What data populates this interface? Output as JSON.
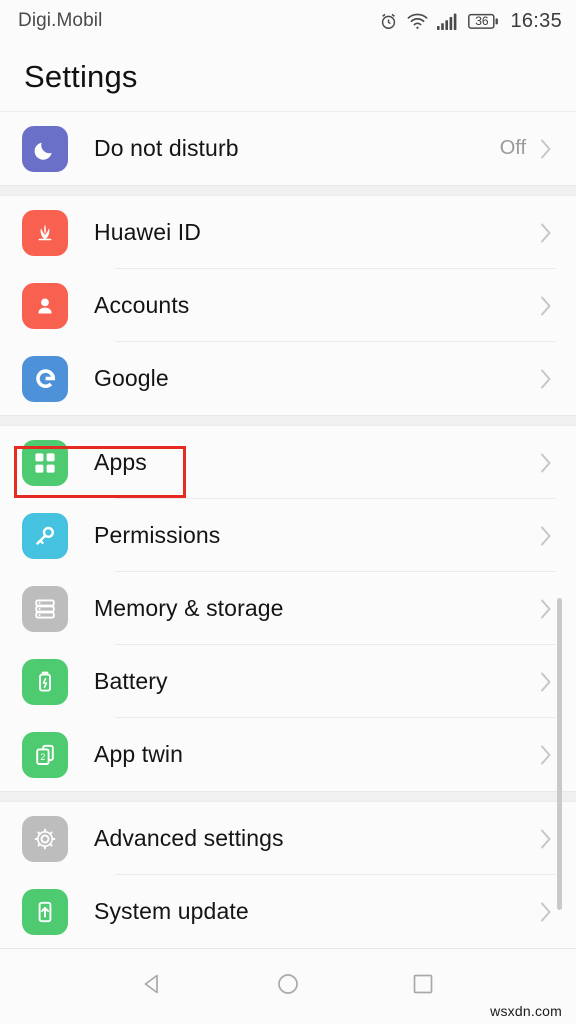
{
  "status_bar": {
    "carrier": "Digi.Mobil",
    "battery_percent": "36",
    "clock": "16:35",
    "icons": [
      "alarm-icon",
      "wifi-icon",
      "signal-icon",
      "battery-icon"
    ]
  },
  "header": {
    "title": "Settings"
  },
  "groups": [
    {
      "rows": [
        {
          "label": "Do not disturb",
          "value": "Off",
          "icon": "moon-icon",
          "icon_color": "#6a6fc8",
          "chevron": true,
          "highlighted": false
        }
      ]
    },
    {
      "rows": [
        {
          "label": "Huawei ID",
          "value": "",
          "icon": "huawei-flower-icon",
          "icon_color": "#f8604f",
          "chevron": true,
          "highlighted": false
        },
        {
          "label": "Accounts",
          "value": "",
          "icon": "person-icon",
          "icon_color": "#f8604f",
          "chevron": true,
          "highlighted": false
        },
        {
          "label": "Google",
          "value": "",
          "icon": "google-g-icon",
          "icon_color": "#4d92d9",
          "chevron": true,
          "highlighted": false
        }
      ]
    },
    {
      "rows": [
        {
          "label": "Apps",
          "value": "",
          "icon": "apps-grid-icon",
          "icon_color": "#4ecb71",
          "chevron": true,
          "highlighted": true
        },
        {
          "label": "Permissions",
          "value": "",
          "icon": "key-icon",
          "icon_color": "#45c2e0",
          "chevron": true,
          "highlighted": false
        },
        {
          "label": "Memory & storage",
          "value": "",
          "icon": "storage-icon",
          "icon_color": "#bdbdbd",
          "chevron": true,
          "highlighted": false
        },
        {
          "label": "Battery",
          "value": "",
          "icon": "battery-bolt-icon",
          "icon_color": "#4ecb71",
          "chevron": true,
          "highlighted": false
        },
        {
          "label": "App twin",
          "value": "",
          "icon": "app-twin-icon",
          "icon_color": "#4ecb71",
          "chevron": true,
          "highlighted": false
        }
      ]
    },
    {
      "rows": [
        {
          "label": "Advanced settings",
          "value": "",
          "icon": "gear-icon",
          "icon_color": "#bdbdbd",
          "chevron": true,
          "highlighted": false
        },
        {
          "label": "System update",
          "value": "",
          "icon": "system-update-icon",
          "icon_color": "#4ecb71",
          "chevron": true,
          "highlighted": false
        }
      ]
    }
  ],
  "annotation": {
    "color": "#e32b22",
    "target": "Apps"
  },
  "nav_bar": {
    "buttons": [
      {
        "name": "back-button",
        "icon": "triangle-left-icon"
      },
      {
        "name": "home-button",
        "icon": "circle-icon"
      },
      {
        "name": "recents-button",
        "icon": "square-icon"
      }
    ]
  },
  "watermark": "wsxdn.com"
}
